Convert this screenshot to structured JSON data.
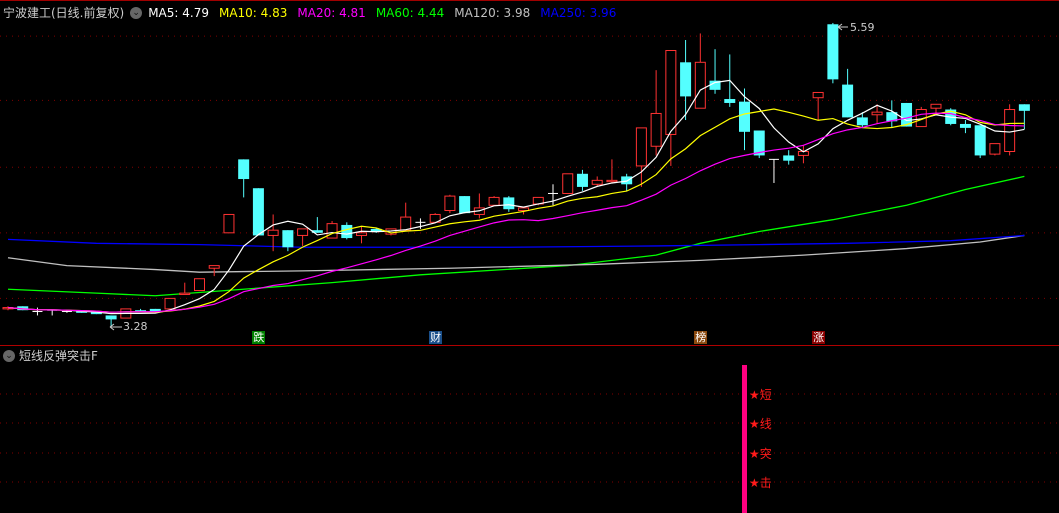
{
  "header": {
    "title": "宁波建工(日线.前复权)",
    "ma": [
      {
        "label": "MA5: 4.79",
        "color": "#ffffff"
      },
      {
        "label": "MA10: 4.83",
        "color": "#ffff00"
      },
      {
        "label": "MA20: 4.81",
        "color": "#ff00ff"
      },
      {
        "label": "MA60: 4.44",
        "color": "#00ff00"
      },
      {
        "label": "MA120: 3.98",
        "color": "#c0c0c0"
      },
      {
        "label": "MA250: 3.96",
        "color": "#0000ff"
      }
    ]
  },
  "annotations": {
    "low": "3.28",
    "high": "5.59"
  },
  "badges": [
    {
      "text": "跌",
      "index": 17,
      "color": "#008000"
    },
    {
      "text": "财",
      "index": 29,
      "color": "#1a4f8a"
    },
    {
      "text": "榜",
      "index": 47,
      "color": "#8b4a10"
    },
    {
      "text": "涨",
      "index": 55,
      "color": "#8b0000"
    }
  ],
  "indicator": {
    "title": "短线反弹突击F",
    "signal_chars": [
      "★短",
      "★线",
      "★突",
      "★击"
    ],
    "bar_color": "#ff0080"
  },
  "colors": {
    "up": "#ff3232",
    "down": "#54ffff",
    "grid": "#800000"
  },
  "chart_data": {
    "type": "candlestick",
    "candles": [
      [
        3.41,
        3.43,
        3.4,
        3.42
      ],
      [
        3.43,
        3.43,
        3.4,
        3.4
      ],
      [
        3.39,
        3.42,
        3.36,
        3.39
      ],
      [
        3.4,
        3.4,
        3.36,
        3.4
      ],
      [
        3.39,
        3.4,
        3.38,
        3.39
      ],
      [
        3.39,
        3.4,
        3.38,
        3.38
      ],
      [
        3.39,
        3.39,
        3.37,
        3.37
      ],
      [
        3.36,
        3.36,
        3.28,
        3.33
      ],
      [
        3.34,
        3.41,
        3.34,
        3.41
      ],
      [
        3.4,
        3.41,
        3.39,
        3.39
      ],
      [
        3.41,
        3.41,
        3.39,
        3.39
      ],
      [
        3.41,
        3.49,
        3.4,
        3.49
      ],
      [
        3.52,
        3.61,
        3.52,
        3.53
      ],
      [
        3.55,
        3.64,
        3.55,
        3.64
      ],
      [
        3.72,
        3.74,
        3.66,
        3.74
      ],
      [
        3.99,
        4.13,
        3.99,
        4.13
      ],
      [
        4.55,
        4.55,
        4.26,
        4.4
      ],
      [
        4.33,
        4.33,
        3.97,
        3.97
      ],
      [
        3.97,
        4.13,
        3.85,
        4.01
      ],
      [
        4.01,
        4.01,
        3.85,
        3.88
      ],
      [
        3.97,
        4.02,
        3.89,
        4.02
      ],
      [
        4.01,
        4.11,
        3.99,
        3.99
      ],
      [
        3.95,
        4.08,
        3.95,
        4.06
      ],
      [
        4.05,
        4.07,
        3.94,
        3.95
      ],
      [
        3.97,
        4.04,
        3.91,
        3.99
      ],
      [
        4.02,
        4.03,
        3.99,
        4.0
      ],
      [
        3.98,
        4.02,
        3.97,
        4.02
      ],
      [
        4.01,
        4.22,
        4.0,
        4.11
      ],
      [
        4.07,
        4.1,
        4.02,
        4.07
      ],
      [
        4.07,
        4.14,
        4.07,
        4.13
      ],
      [
        4.16,
        4.28,
        4.14,
        4.27
      ],
      [
        4.27,
        4.27,
        4.14,
        4.14
      ],
      [
        4.13,
        4.29,
        4.1,
        4.18
      ],
      [
        4.2,
        4.27,
        4.2,
        4.26
      ],
      [
        4.26,
        4.27,
        4.15,
        4.17
      ],
      [
        4.16,
        4.18,
        4.13,
        4.18
      ],
      [
        4.21,
        4.26,
        4.2,
        4.26
      ],
      [
        4.29,
        4.36,
        4.2,
        4.29
      ],
      [
        4.29,
        4.44,
        4.29,
        4.44
      ],
      [
        4.44,
        4.47,
        4.31,
        4.34
      ],
      [
        4.36,
        4.42,
        4.34,
        4.39
      ],
      [
        4.38,
        4.55,
        4.37,
        4.39
      ],
      [
        4.42,
        4.44,
        4.31,
        4.36
      ],
      [
        4.5,
        4.79,
        4.34,
        4.79
      ],
      [
        4.65,
        5.23,
        4.58,
        4.9
      ],
      [
        4.74,
        5.38,
        4.5,
        5.38
      ],
      [
        5.29,
        5.46,
        4.85,
        5.03
      ],
      [
        4.94,
        5.51,
        4.94,
        5.29
      ],
      [
        5.15,
        5.39,
        5.05,
        5.08
      ],
      [
        5.01,
        5.35,
        4.95,
        4.98
      ],
      [
        4.99,
        5.09,
        4.62,
        4.76
      ],
      [
        4.77,
        4.77,
        4.56,
        4.58
      ],
      [
        4.55,
        4.55,
        4.37,
        4.55
      ],
      [
        4.58,
        4.62,
        4.51,
        4.54
      ],
      [
        4.58,
        4.66,
        4.52,
        4.61
      ],
      [
        5.02,
        5.06,
        4.85,
        5.06
      ],
      [
        5.58,
        5.59,
        5.13,
        5.16
      ],
      [
        5.12,
        5.24,
        4.87,
        4.87
      ],
      [
        4.87,
        4.91,
        4.79,
        4.81
      ],
      [
        4.89,
        4.97,
        4.82,
        4.91
      ],
      [
        4.91,
        5.0,
        4.79,
        4.84
      ],
      [
        4.98,
        4.98,
        4.8,
        4.8
      ],
      [
        4.8,
        4.95,
        4.8,
        4.93
      ],
      [
        4.94,
        4.97,
        4.9,
        4.97
      ],
      [
        4.93,
        4.94,
        4.81,
        4.82
      ],
      [
        4.82,
        4.85,
        4.75,
        4.79
      ],
      [
        4.81,
        4.81,
        4.56,
        4.58
      ],
      [
        4.59,
        4.67,
        4.58,
        4.67
      ],
      [
        4.61,
        4.97,
        4.58,
        4.93
      ],
      [
        4.97,
        4.97,
        4.78,
        4.92
      ]
    ],
    "ma_long": {
      "MA60": [
        [
          0,
          3.56
        ],
        [
          6,
          3.53
        ],
        [
          10,
          3.51
        ],
        [
          22,
          3.61
        ],
        [
          28,
          3.67
        ],
        [
          38,
          3.74
        ],
        [
          44,
          3.82
        ],
        [
          47,
          3.91
        ],
        [
          51,
          4.0
        ],
        [
          56,
          4.09
        ],
        [
          61,
          4.2
        ],
        [
          65,
          4.32
        ],
        [
          69,
          4.42
        ]
      ],
      "MA120": [
        [
          0,
          3.8
        ],
        [
          4,
          3.74
        ],
        [
          10,
          3.71
        ],
        [
          13,
          3.69
        ],
        [
          20,
          3.7
        ],
        [
          30,
          3.72
        ],
        [
          40,
          3.75
        ],
        [
          47,
          3.78
        ],
        [
          54,
          3.82
        ],
        [
          61,
          3.87
        ],
        [
          66,
          3.92
        ],
        [
          69,
          3.97
        ]
      ],
      "MA250": [
        [
          0,
          3.94
        ],
        [
          6,
          3.91
        ],
        [
          13,
          3.9
        ],
        [
          20,
          3.88
        ],
        [
          34,
          3.88
        ],
        [
          44,
          3.89
        ],
        [
          51,
          3.9
        ],
        [
          57,
          3.91
        ],
        [
          64,
          3.93
        ],
        [
          69,
          3.97
        ]
      ]
    },
    "grid_prices": [
      5.49,
      5.0,
      4.49,
      3.99,
      3.49
    ],
    "signal_index": 50
  }
}
